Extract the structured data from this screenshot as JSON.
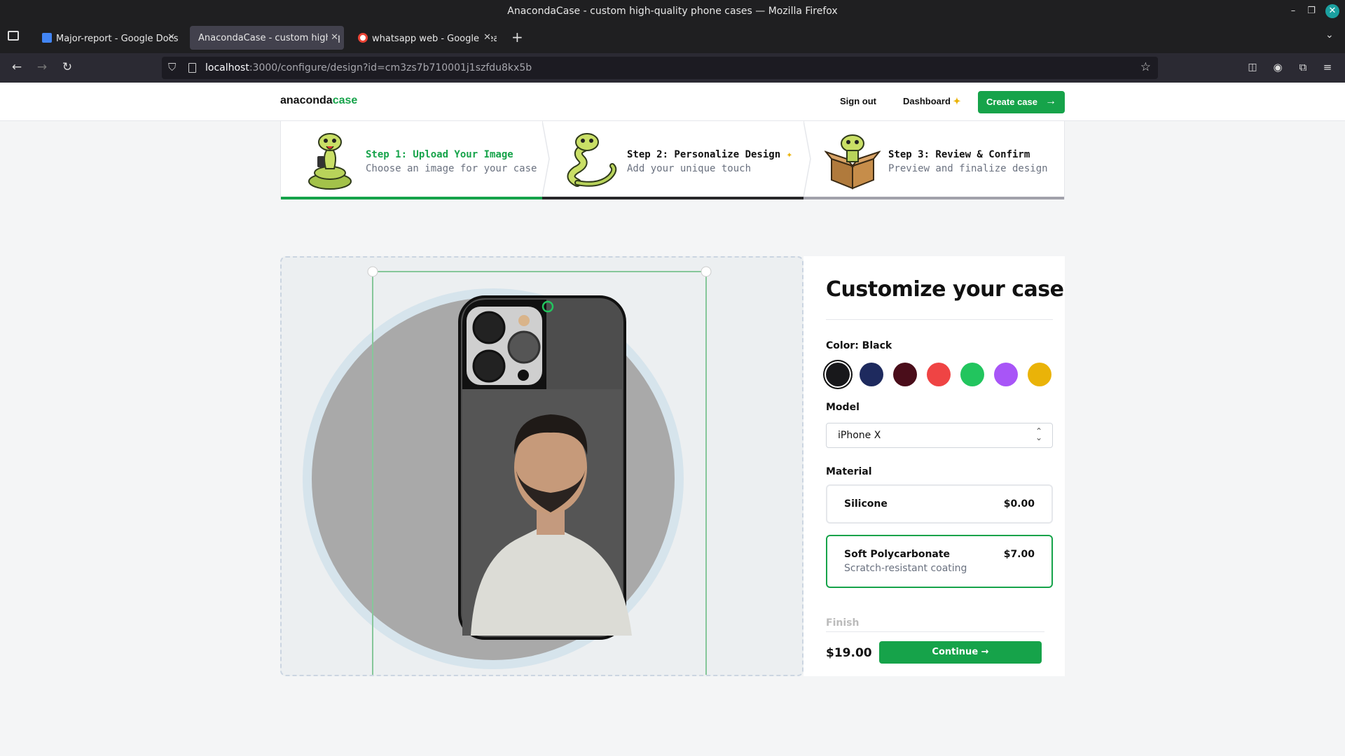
{
  "window": {
    "title": "AnacondaCase - custom high-quality phone cases — Mozilla Firefox"
  },
  "tabs": [
    {
      "label": "Major-report - Google Docs",
      "icon": "google-docs-icon"
    },
    {
      "label": "AnacondaCase - custom high-q",
      "icon": "none"
    },
    {
      "label": "whatsapp web - Google Sea",
      "icon": "google-icon"
    }
  ],
  "urlbar": {
    "host": "localhost",
    "rest": ":3000/configure/design?id=cm3zs7b710001j1szfdu8kx5b"
  },
  "site": {
    "logo_a": "anaconda",
    "logo_b": "case",
    "nav": {
      "sign_out": "Sign out",
      "dashboard": "Dashboard",
      "create": "Create case"
    }
  },
  "steps": [
    {
      "title": "Step 1: Upload Your Image",
      "desc": "Choose an image for your case"
    },
    {
      "title": "Step 2: Personalize Design",
      "desc": "Add your unique touch"
    },
    {
      "title": "Step 3: Review & Confirm",
      "desc": "Preview and finalize design"
    }
  ],
  "panel": {
    "heading": "Customize your case",
    "color_label": "Color: Black",
    "colors": [
      "#18181b",
      "#1e2a5e",
      "#4a0d1a",
      "#ef4444",
      "#22c55e",
      "#a855f7",
      "#eab308"
    ],
    "model_label": "Model",
    "model_value": "iPhone X",
    "material_label": "Material",
    "materials": [
      {
        "name": "Silicone",
        "price": "$0.00",
        "desc": ""
      },
      {
        "name": "Soft Polycarbonate",
        "price": "$7.00",
        "desc": "Scratch-resistant coating"
      }
    ],
    "finish_label": "Finish",
    "total": "$19.00",
    "continue": "Continue"
  }
}
